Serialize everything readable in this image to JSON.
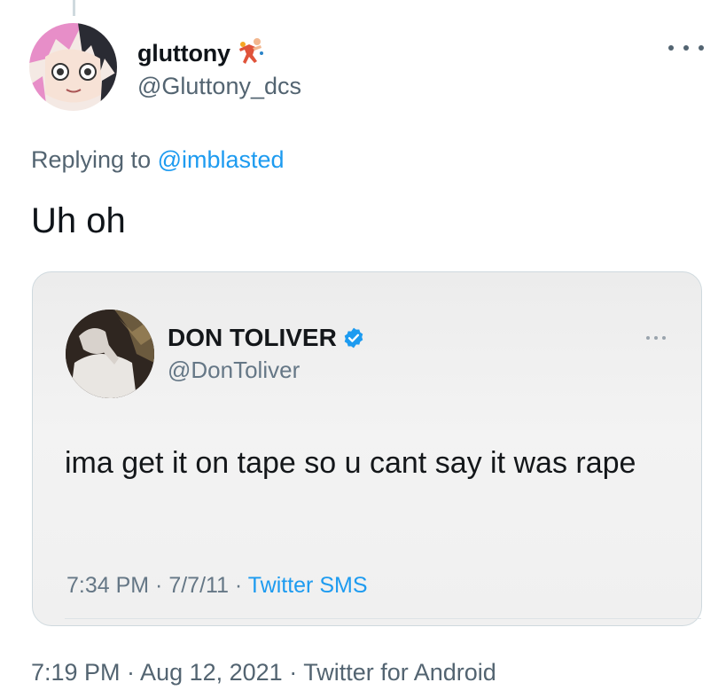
{
  "tweet": {
    "author": {
      "display_name": "gluttony",
      "name_emoji_icon": "person-running-with-ball-emoji",
      "handle": "@Gluttony_dcs",
      "avatar_icon": "anime-avatar"
    },
    "more_icon": "more-horizontal-icon",
    "replying": {
      "prefix": "Replying to",
      "mention": "@imblasted"
    },
    "text": "Uh oh",
    "timestamp": "7:19 PM · Aug 12, 2021 · Twitter for Android"
  },
  "quoted_tweet": {
    "author": {
      "display_name": "DON TOLIVER",
      "verified_icon": "verified-badge-icon",
      "handle": "@DonToliver",
      "avatar_icon": "profile-photo"
    },
    "text": "ima get it on tape so u cant say it was rape",
    "meta_time": "7:34 PM · 7/7/11 · ",
    "meta_source": "Twitter SMS"
  },
  "colors": {
    "link_blue": "#1d9bf0",
    "secondary_text": "#536471",
    "border": "#cfd9de"
  }
}
